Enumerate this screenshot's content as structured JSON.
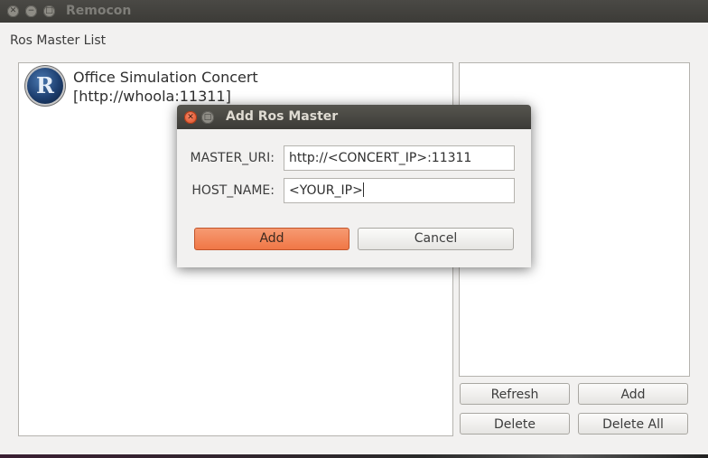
{
  "window": {
    "title": "Remocon",
    "close_glyph": "✕",
    "minimize_glyph": "−",
    "maximize_glyph": "□"
  },
  "main": {
    "section_label": "Ros Master List",
    "masters": [
      {
        "name": "Office Simulation Concert",
        "uri": "[http://whoola:11311]",
        "icon": "ros-logo-icon",
        "icon_letter": "R"
      }
    ],
    "buttons": {
      "refresh": "Refresh",
      "add": "Add",
      "delete": "Delete",
      "delete_all": "Delete All"
    }
  },
  "dialog": {
    "title": "Add Ros Master",
    "close_glyph": "✕",
    "maximize_glyph": "□",
    "fields": {
      "master_uri_label": "MASTER_URI:",
      "master_uri_value": "http://<CONCERT_IP>:11311",
      "host_name_label": "HOST_NAME:",
      "host_name_value": "<YOUR_IP>"
    },
    "buttons": {
      "add": "Add",
      "cancel": "Cancel"
    }
  },
  "colors": {
    "accent": "#f07746",
    "titlebar": "#3c3b37",
    "window_bg": "#f2f1f0"
  }
}
